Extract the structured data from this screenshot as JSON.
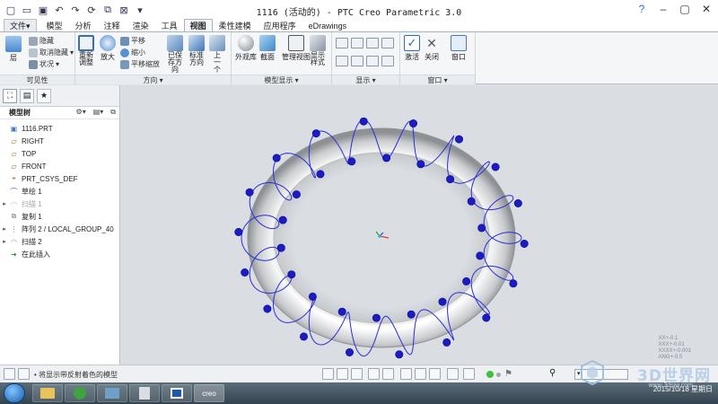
{
  "window": {
    "title": "1116 (活动的) - PTC Creo Parametric 3.0"
  },
  "menu": {
    "tabs": [
      "文件▾",
      "模型",
      "分析",
      "注释",
      "渲染",
      "工具",
      "视图",
      "柔性建模",
      "应用程序",
      "eDrawings"
    ],
    "active_tab": "视图"
  },
  "ribbon": {
    "visibility": {
      "label": "可见性",
      "layers": "层",
      "hide": "隐藏",
      "unhide": "取消隐藏",
      "status": "状况"
    },
    "orientation": {
      "label": "方向",
      "refit": "重新调整",
      "zoom_in": "放大",
      "pan": "平移",
      "zoom_out": "缩小",
      "pan_zoom": "平移缩放",
      "saved_orientations": "已保存方向",
      "standard_orientation": "标准方向",
      "previous": "上一个"
    },
    "model_display": {
      "label": "模型显示",
      "appearance": "外观库",
      "section": "截面",
      "manage_views": "管理视图",
      "display_style": "显示样式"
    },
    "show": {
      "label": "显示"
    },
    "window": {
      "label": "窗口",
      "activate": "激活",
      "close": "关闭",
      "windows": "窗口"
    }
  },
  "model_tree": {
    "header": "模型树",
    "items": [
      {
        "label": "1116.PRT",
        "icon": "part-icon",
        "expand": "",
        "indent": 0,
        "gray": false
      },
      {
        "label": "RIGHT",
        "icon": "datum-plane-icon",
        "expand": "",
        "indent": 1,
        "gray": false
      },
      {
        "label": "TOP",
        "icon": "datum-plane-icon",
        "expand": "",
        "indent": 1,
        "gray": false
      },
      {
        "label": "FRONT",
        "icon": "datum-plane-icon",
        "expand": "",
        "indent": 1,
        "gray": false
      },
      {
        "label": "PRT_CSYS_DEF",
        "icon": "csys-icon",
        "expand": "",
        "indent": 1,
        "gray": false
      },
      {
        "label": "草绘 1",
        "icon": "sketch-icon",
        "expand": "",
        "indent": 1,
        "gray": false
      },
      {
        "label": "扫描 1",
        "icon": "sweep-icon",
        "expand": "▸",
        "indent": 0,
        "gray": true
      },
      {
        "label": "复制 1",
        "icon": "copy-icon",
        "expand": "",
        "indent": 1,
        "gray": false
      },
      {
        "label": "阵列 2 / LOCAL_GROUP_40",
        "icon": "pattern-icon",
        "expand": "▸",
        "indent": 0,
        "gray": false
      },
      {
        "label": "扫描 2",
        "icon": "sweep-icon",
        "expand": "▸",
        "indent": 0,
        "gray": false
      },
      {
        "label": "在此插入",
        "icon": "insert-here-icon",
        "expand": "",
        "indent": 1,
        "gray": false
      }
    ]
  },
  "status": {
    "message": "• 将显示带反射着色的模型"
  },
  "taskbar": {
    "time": "",
    "date": "2015/10/18 星期日"
  },
  "watermark": {
    "brand": "3D世界网",
    "url": "www.3dsjw.com"
  },
  "viewport": {
    "coords_lines": [
      "XX+-0.1",
      "XXX+-0.01",
      "XXXX+-0.001",
      "ANG+-0.5"
    ]
  },
  "colors": {
    "accent": "#1a56c4",
    "helix": "#2c2cd8",
    "marker": "#1b1bc9",
    "canvas_bg": "#dadee2"
  }
}
